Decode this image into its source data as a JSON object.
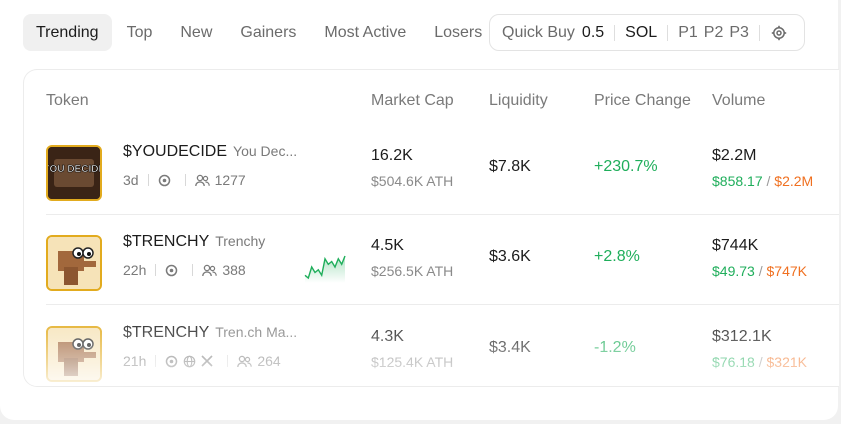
{
  "tabs": [
    {
      "label": "Trending",
      "active": true
    },
    {
      "label": "Top",
      "active": false
    },
    {
      "label": "New",
      "active": false
    },
    {
      "label": "Gainers",
      "active": false
    },
    {
      "label": "Most Active",
      "active": false
    },
    {
      "label": "Losers",
      "active": false
    }
  ],
  "quick_buy": {
    "label": "Quick Buy",
    "amount": "0.5",
    "currency": "SOL",
    "presets": [
      "P1",
      "P2",
      "P3"
    ],
    "settings_icon": "gear-icon"
  },
  "table": {
    "headers": {
      "token": "Token",
      "market_cap": "Market Cap",
      "liquidity": "Liquidity",
      "price_change": "Price Change",
      "volume": "Volume"
    },
    "rows": [
      {
        "symbol": "$YOUDECIDE",
        "name": "You Dec...",
        "avatar_text": "YOU DECIDE",
        "age": "3d",
        "holders": "1277",
        "market_cap": "16.2K",
        "ath": "$504.6K ATH",
        "liquidity": "$7.8K",
        "price_change": "+230.7%",
        "volume": "$2.2M",
        "buy_volume": "$858.17",
        "sell_volume": "$2.2M",
        "icons": [
          "pump-icon",
          "users-icon"
        ]
      },
      {
        "symbol": "$TRENCHY",
        "name": "Trenchy",
        "age": "22h",
        "holders": "388",
        "market_cap": "4.5K",
        "ath": "$256.5K ATH",
        "liquidity": "$3.6K",
        "price_change": "+2.8%",
        "volume": "$744K",
        "buy_volume": "$49.73",
        "sell_volume": "$747K",
        "sparkline": [
          3,
          2,
          6,
          4,
          5,
          3,
          9,
          7,
          8,
          6,
          9,
          7,
          10
        ],
        "icons": [
          "pump-icon",
          "users-icon"
        ]
      },
      {
        "symbol": "$TRENCHY",
        "name": "Tren.ch Ma...",
        "age": "21h",
        "holders": "264",
        "market_cap": "4.3K",
        "ath": "$125.4K ATH",
        "liquidity": "$3.4K",
        "price_change": "-1.2%",
        "volume": "$312.1K",
        "buy_volume": "$76.18",
        "sell_volume": "$321K",
        "icons": [
          "pump-icon",
          "globe-icon",
          "x-icon",
          "users-icon"
        ]
      }
    ]
  },
  "colors": {
    "positive": "#1fae5b",
    "sell": "#f07020",
    "avatar_border": "#e2ab1e"
  }
}
